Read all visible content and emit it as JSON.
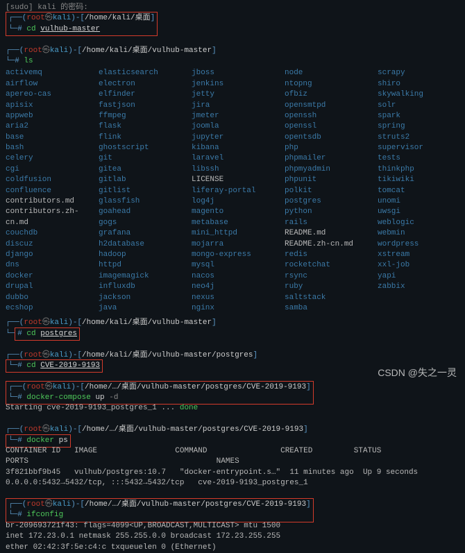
{
  "sudo_line": "[sudo] kali 的密码:",
  "prompts": {
    "p1": {
      "user": "root",
      "host": "kali",
      "path": "/home/kali/桌面"
    },
    "p2": {
      "user": "root",
      "host": "kali",
      "path": "/home/kali/桌面/vulhub-master"
    },
    "p3": {
      "user": "root",
      "host": "kali",
      "path": "/home/kali/桌面/vulhub-master"
    },
    "p4": {
      "user": "root",
      "host": "kali",
      "path": "/home/kali/桌面/vulhub-master/postgres"
    },
    "p5": {
      "user": "root",
      "host": "kali",
      "path": "/home/…/桌面/vulhub-master/postgres/CVE-2019-9193"
    },
    "p6": {
      "user": "root",
      "host": "kali",
      "path": "/home/…/桌面/vulhub-master/postgres/CVE-2019-9193"
    },
    "p7": {
      "user": "root",
      "host": "kali",
      "path": "/home/…/桌面/vulhub-master/postgres/CVE-2019-9193"
    }
  },
  "cmds": {
    "cd1": "cd",
    "cd1_arg": "vulhub-master",
    "ls": "ls",
    "cd2": "cd",
    "cd2_arg": "postgres",
    "cd3": "cd",
    "cd3_arg": "CVE-2019-9193",
    "dc": "docker-compose",
    "dc_sub": "up",
    "dc_flag": "-d",
    "dps": "docker",
    "dps_sub": "ps",
    "ifc": "ifconfig"
  },
  "starting": "Starting cve-2019-9193_postgres_1   ...",
  "done": "done",
  "ps_header": {
    "c1": "CONTAINER ID",
    "c2": "IMAGE",
    "c3": "COMMAND",
    "c4": "CREATED",
    "c5": "STATUS",
    "r2": "PORTS",
    "r2b": "NAMES"
  },
  "ps_row": {
    "id": "3f821bbf9b45",
    "img": "vulhub/postgres:10.7",
    "cmd": "\"docker-entrypoint.s…\"",
    "created": "11 minutes ago",
    "status": "Up 9 seconds",
    "ports": "0.0.0.0:5432→5432/tcp, :::5432→5432/tcp",
    "names": "cve-2019-9193_postgres_1"
  },
  "ifc_out": {
    "l1": "br-209693721f43: flags=4099<UP,BROADCAST,MULTICAST>  mtu 1500",
    "l2": "        inet 172.23.0.1  netmask 255.255.0.0  broadcast 172.23.255.255",
    "l3": "        ether 02:42:3f:5e:c4:c  txqueuelen 0  (Ethernet)"
  },
  "listing": [
    [
      "activemq",
      "link"
    ],
    [
      "airflow",
      "link"
    ],
    [
      "apereo-cas",
      "link"
    ],
    [
      "apisix",
      "link"
    ],
    [
      "appweb",
      "link"
    ],
    [
      "aria2",
      "link"
    ],
    [
      "base",
      "link"
    ],
    [
      "bash",
      "link"
    ],
    [
      "celery",
      "link"
    ],
    [
      "cgi",
      "link"
    ],
    [
      "coldfusion",
      "link"
    ],
    [
      "confluence",
      "link"
    ],
    [
      "contributors.md",
      "plain"
    ],
    [
      "contributors.zh-cn.md",
      "plain"
    ],
    [
      "couchdb",
      "link"
    ],
    [
      "discuz",
      "link"
    ],
    [
      "django",
      "link"
    ],
    [
      "dns",
      "link"
    ],
    [
      "docker",
      "link"
    ],
    [
      "drupal",
      "link"
    ],
    [
      "dubbo",
      "link"
    ],
    [
      "ecshop",
      "link"
    ],
    [
      "elasticsearch",
      "link"
    ],
    [
      "electron",
      "link"
    ],
    [
      "elfinder",
      "link"
    ],
    [
      "fastjson",
      "link"
    ],
    [
      "ffmpeg",
      "link"
    ],
    [
      "flask",
      "link"
    ],
    [
      "flink",
      "link"
    ],
    [
      "ghostscript",
      "link"
    ],
    [
      "git",
      "link"
    ],
    [
      "gitea",
      "link"
    ],
    [
      "gitlab",
      "link"
    ],
    [
      "gitlist",
      "link"
    ],
    [
      "glassfish",
      "link"
    ],
    [
      "goahead",
      "link"
    ],
    [
      "gogs",
      "link"
    ],
    [
      "grafana",
      "link"
    ],
    [
      "h2database",
      "link"
    ],
    [
      "hadoop",
      "link"
    ],
    [
      "httpd",
      "link"
    ],
    [
      "imagemagick",
      "link"
    ],
    [
      "influxdb",
      "link"
    ],
    [
      "jackson",
      "link"
    ],
    [
      "java",
      "link"
    ],
    [
      "jboss",
      "link"
    ],
    [
      "jenkins",
      "link"
    ],
    [
      "jetty",
      "link"
    ],
    [
      "jira",
      "link"
    ],
    [
      "jmeter",
      "link"
    ],
    [
      "joomla",
      "link"
    ],
    [
      "jupyter",
      "link"
    ],
    [
      "kibana",
      "link"
    ],
    [
      "laravel",
      "link"
    ],
    [
      "libssh",
      "link"
    ],
    [
      "LICENSE",
      "plain"
    ],
    [
      "liferay-portal",
      "link"
    ],
    [
      "log4j",
      "link"
    ],
    [
      "magento",
      "link"
    ],
    [
      "metabase",
      "link"
    ],
    [
      "mini_httpd",
      "link"
    ],
    [
      "mojarra",
      "link"
    ],
    [
      "mongo-express",
      "link"
    ],
    [
      "mysql",
      "link"
    ],
    [
      "nacos",
      "link"
    ],
    [
      "neo4j",
      "link"
    ],
    [
      "nexus",
      "link"
    ],
    [
      "nginx",
      "link"
    ],
    [
      "node",
      "link"
    ],
    [
      "ntopng",
      "link"
    ],
    [
      "ofbiz",
      "link"
    ],
    [
      "opensmtpd",
      "link"
    ],
    [
      "openssh",
      "link"
    ],
    [
      "openssl",
      "link"
    ],
    [
      "opentsdb",
      "link"
    ],
    [
      "php",
      "link"
    ],
    [
      "phpmailer",
      "link"
    ],
    [
      "phpmyadmin",
      "link"
    ],
    [
      "phpunit",
      "link"
    ],
    [
      "polkit",
      "link"
    ],
    [
      "postgres",
      "link"
    ],
    [
      "python",
      "link"
    ],
    [
      "rails",
      "link"
    ],
    [
      "README.md",
      "plain"
    ],
    [
      "README.zh-cn.md",
      "plain"
    ],
    [
      "redis",
      "link"
    ],
    [
      "rocketchat",
      "link"
    ],
    [
      "rsync",
      "link"
    ],
    [
      "ruby",
      "link"
    ],
    [
      "saltstack",
      "link"
    ],
    [
      "samba",
      "link"
    ],
    [
      "scrapy",
      "link"
    ],
    [
      "shiro",
      "link"
    ],
    [
      "skywalking",
      "link"
    ],
    [
      "solr",
      "link"
    ],
    [
      "spark",
      "link"
    ],
    [
      "spring",
      "link"
    ],
    [
      "struts2",
      "link"
    ],
    [
      "supervisor",
      "link"
    ],
    [
      "tests",
      "link"
    ],
    [
      "thinkphp",
      "link"
    ],
    [
      "tikiwiki",
      "link"
    ],
    [
      "tomcat",
      "link"
    ],
    [
      "unomi",
      "link"
    ],
    [
      "uwsgi",
      "link"
    ],
    [
      "weblogic",
      "link"
    ],
    [
      "webmin",
      "link"
    ],
    [
      "wordpress",
      "link"
    ],
    [
      "xstream",
      "link"
    ],
    [
      "xxl-job",
      "link"
    ],
    [
      "yapi",
      "link"
    ],
    [
      "zabbix",
      "link"
    ]
  ],
  "watermark": "CSDN @失之一灵"
}
